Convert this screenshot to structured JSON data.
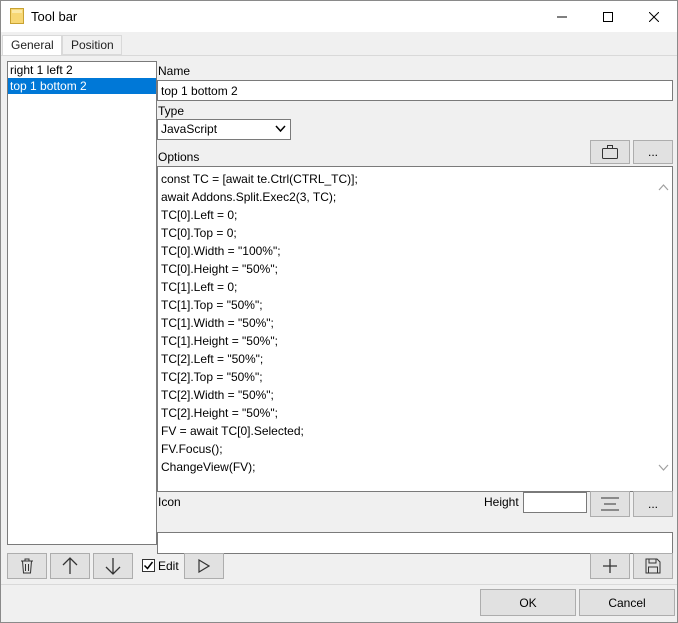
{
  "window": {
    "title": "Tool bar"
  },
  "tabs": [
    {
      "label": "General"
    },
    {
      "label": "Position"
    }
  ],
  "list": {
    "items": [
      {
        "label": "right 1 left 2",
        "selected": false
      },
      {
        "label": "top 1 bottom 2",
        "selected": true
      }
    ]
  },
  "form": {
    "name_label": "Name",
    "name_value": "top 1 bottom 2",
    "type_label": "Type",
    "type_value": "JavaScript",
    "options_label": "Options",
    "options_lines": [
      "const TC = [await te.Ctrl(CTRL_TC)];",
      "await Addons.Split.Exec2(3, TC);",
      "TC[0].Left = 0;",
      "TC[0].Top = 0;",
      "TC[0].Width = \"100%\";",
      "TC[0].Height = \"50%\";",
      "TC[1].Left = 0;",
      "TC[1].Top = \"50%\";",
      "TC[1].Width = \"50%\";",
      "TC[1].Height = \"50%\";",
      "TC[2].Left = \"50%\";",
      "TC[2].Top = \"50%\";",
      "TC[2].Width = \"50%\";",
      "TC[2].Height = \"50%\";",
      "FV = await TC[0].Selected;",
      "FV.Focus();",
      "ChangeView(FV);"
    ],
    "icon_label": "Icon",
    "height_label": "Height",
    "height_value": "",
    "icon_value": ""
  },
  "buttons": {
    "browse_label": "...",
    "icon_browse_label": "...",
    "edit_label": "Edit",
    "edit_checked": true,
    "ok_label": "OK",
    "cancel_label": "Cancel"
  },
  "colors": {
    "selection": "#0078d7",
    "window_bg": "#f0f0f0",
    "button_bg": "#e1e1e1"
  }
}
